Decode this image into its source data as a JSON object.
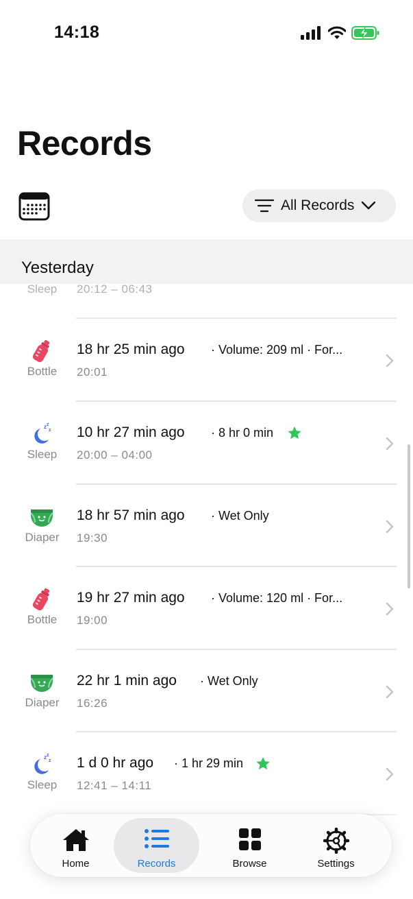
{
  "status_bar": {
    "time": "14:18"
  },
  "header": {
    "title": "Records",
    "filter_label": "All Records"
  },
  "section": {
    "title": "Yesterday"
  },
  "partial_row": {
    "type": "Sleep",
    "time": "20:12 – 06:43"
  },
  "records": [
    {
      "type": "Bottle",
      "icon": "bottle-icon",
      "ago": "18 hr 25 min  ago",
      "detail": "· Volume: 209 ml · For...",
      "time": "20:01",
      "star": false
    },
    {
      "type": "Sleep",
      "icon": "sleep-icon",
      "ago": "10 hr 27 min  ago",
      "detail": "· 8 hr 0 min",
      "time": "20:00 – 04:00",
      "star": true
    },
    {
      "type": "Diaper",
      "icon": "diaper-icon",
      "ago": "18 hr 57 min  ago",
      "detail": "· Wet Only",
      "time": "19:30",
      "star": false
    },
    {
      "type": "Bottle",
      "icon": "bottle-icon",
      "ago": "19 hr 27 min  ago",
      "detail": "· Volume: 120 ml · For...",
      "time": "19:00",
      "star": false
    },
    {
      "type": "Diaper",
      "icon": "diaper-icon",
      "ago": "22 hr 1 min  ago",
      "detail": "· Wet Only",
      "time": "16:26",
      "star": false
    },
    {
      "type": "Sleep",
      "icon": "sleep-icon",
      "ago": "1 d 0 hr  ago",
      "detail": "· 1 hr 29 min",
      "time": "12:41 – 14:11",
      "star": true
    }
  ],
  "tab_bar": {
    "tabs": [
      {
        "label": "Home",
        "icon": "home-icon",
        "active": false
      },
      {
        "label": "Records",
        "icon": "list-icon",
        "active": true
      },
      {
        "label": "Browse",
        "icon": "grid-icon",
        "active": false
      },
      {
        "label": "Settings",
        "icon": "gear-icon",
        "active": false
      }
    ]
  },
  "colors": {
    "accent": "#1e7ae0",
    "bottle": "#e8475f",
    "sleep": "#3f6fe0",
    "diaper": "#34a853",
    "star": "#2ec55a",
    "battery": "#34c759"
  }
}
